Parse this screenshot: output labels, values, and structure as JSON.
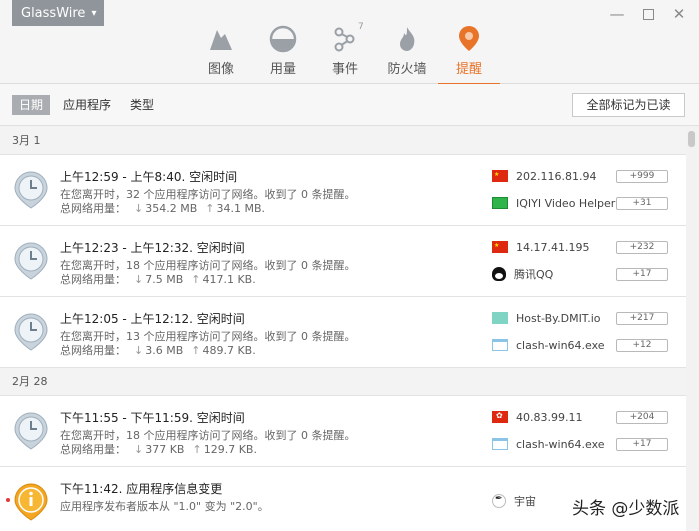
{
  "app": {
    "name": "GlassWire"
  },
  "nav": [
    {
      "label": "图像",
      "icon": "graph-icon"
    },
    {
      "label": "用量",
      "icon": "usage-icon"
    },
    {
      "label": "事件",
      "icon": "events-icon",
      "badge": "7"
    },
    {
      "label": "防火墙",
      "icon": "firewall-icon"
    },
    {
      "label": "提醒",
      "icon": "alerts-icon",
      "active": true
    }
  ],
  "filters": [
    {
      "label": "日期",
      "active": true
    },
    {
      "label": "应用程序"
    },
    {
      "label": "类型"
    }
  ],
  "mark_all_label": "全部标记为已读",
  "groups": [
    {
      "date": "3月 1"
    },
    {
      "date": "2月 28"
    }
  ],
  "alerts": [
    {
      "title": "上午12:59 - 上午8:40. 空闲时间",
      "sub": "在您离开时，32 个应用程序访问了网络。收到了 0 条提醒。",
      "usage_label": "总网络用量：",
      "down": "354.2 MB",
      "up": "34.1 MB.",
      "apps": [
        {
          "flag": "cn",
          "name": "202.116.81.94",
          "count": "+999"
        },
        {
          "flag": "iqiyi",
          "name": "IQIYI Video Helper",
          "count": "+31"
        }
      ]
    },
    {
      "title": "上午12:23 - 上午12:32. 空闲时间",
      "sub": "在您离开时，18 个应用程序访问了网络。收到了 0 条提醒。",
      "usage_label": "总网络用量：",
      "down": "7.5 MB",
      "up": "417.1 KB.",
      "apps": [
        {
          "flag": "cn",
          "name": "14.17.41.195",
          "count": "+232"
        },
        {
          "flag": "qq",
          "name": "腾讯QQ",
          "count": "+17"
        }
      ]
    },
    {
      "title": "上午12:05 - 上午12:12. 空闲时间",
      "sub": "在您离开时，13 个应用程序访问了网络。收到了 0 条提醒。",
      "usage_label": "总网络用量：",
      "down": "3.6 MB",
      "up": "489.7 KB.",
      "apps": [
        {
          "flag": "world",
          "name": "Host-By.DMIT.io",
          "count": "+217"
        },
        {
          "flag": "window",
          "name": "clash-win64.exe",
          "count": "+12"
        }
      ]
    },
    {
      "title": "下午11:55 - 下午11:59. 空闲时间",
      "sub": "在您离开时，18 个应用程序访问了网络。收到了 0 条提醒。",
      "usage_label": "总网络用量：",
      "down": "377 KB",
      "up": "129.7 KB.",
      "apps": [
        {
          "flag": "hk",
          "name": "40.83.99.11",
          "count": "+204"
        },
        {
          "flag": "window",
          "name": "clash-win64.exe",
          "count": "+17"
        }
      ]
    },
    {
      "title": "下午11:42. 应用程序信息变更",
      "sub": "应用程序发布者版本从 \"1.0\" 变为 \"2.0\"。",
      "apps": [
        {
          "flag": "pen",
          "name": "宇宙"
        }
      ]
    }
  ],
  "watermark": "头条 @少数派"
}
